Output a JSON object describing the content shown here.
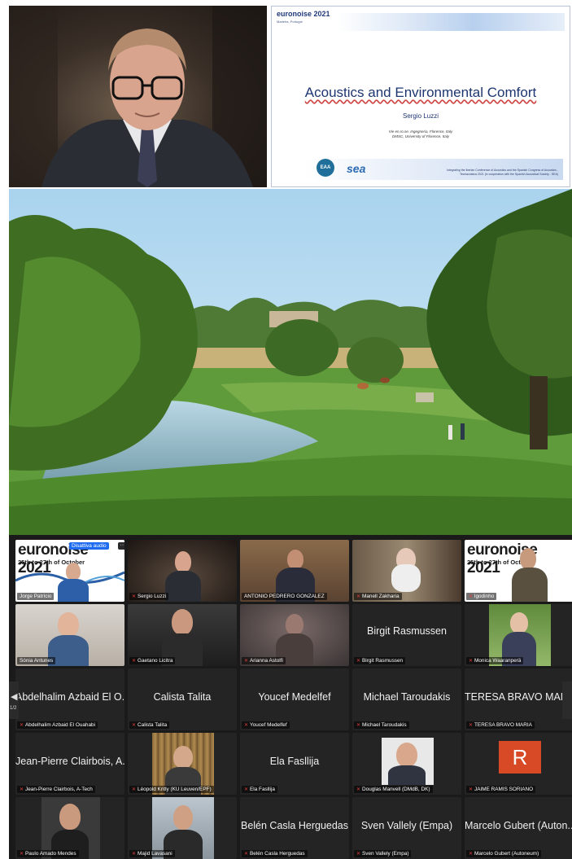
{
  "slide": {
    "logo": "euronoise 2021",
    "logo_sub": "Madeira, Portugal",
    "title": "Acoustics and Environmental Comfort",
    "author": "Sergio Luzzi",
    "affiliation_1": "Vie en.ro.se. Ingegneria, Florence, Italy",
    "affiliation_2": "DMSC, University of Florence, Italy",
    "eaa": "EAA",
    "sea": "sea",
    "footer_text": "Integrating the Iberian Conference of Acoustics and the Spanish Congress of Acoustics - Tecniacústica 2021 (in cooperation with the Spanish Acoustical Society - SEA)"
  },
  "gallery": {
    "euro_bg_text": "euronoise 2021",
    "euro_bg_dates": "25th to 27th of October",
    "active_badge": "Disattiva audio",
    "more_icon": "···",
    "page_indicator": "1/2",
    "avatar_letter": "R",
    "tiles": [
      {
        "label": "Jorge Patrício",
        "center": ""
      },
      {
        "label": "Sergio Luzzi",
        "center": ""
      },
      {
        "label": "ANTONIO PEDRERO GONZALEZ",
        "center": ""
      },
      {
        "label": "Manell Zakharia",
        "center": ""
      },
      {
        "label": "lgodinho",
        "center": ""
      },
      {
        "label": "Sónia Antunes",
        "center": ""
      },
      {
        "label": "Gaetano Licitra",
        "center": ""
      },
      {
        "label": "Arianna Astolfi",
        "center": ""
      },
      {
        "label": "Birgit Rasmussen",
        "center": "Birgit Rasmussen"
      },
      {
        "label": "Monica Waaranperä",
        "center": ""
      },
      {
        "label": "Abdelhalim Azbaid El Ouahabi",
        "center": "Abdelhalim Azbaid El O..."
      },
      {
        "label": "Calista Talita",
        "center": "Calista Talita"
      },
      {
        "label": "Youcef Medelfef",
        "center": "Youcef Medelfef"
      },
      {
        "label": "Michael Taroudakis",
        "center": "Michael Taroudakis"
      },
      {
        "label": "TERESA BRAVO MARIA",
        "center": "TERESA BRAVO MARIA"
      },
      {
        "label": "Jean-Pierre Clairbois, A-Tech",
        "center": "Jean-Pierre Clairbois, A..."
      },
      {
        "label": "Léopold Kritly (KU Leuven/EPF)",
        "center": ""
      },
      {
        "label": "Ela Fasllija",
        "center": "Ela Fasllija"
      },
      {
        "label": "Douglas Manvell (DMdB, DK)",
        "center": ""
      },
      {
        "label": "JAIME RAMIS SORIANO",
        "center": ""
      },
      {
        "label": "Paulo Amado Mendes",
        "center": ""
      },
      {
        "label": "Majid Lavasani",
        "center": ""
      },
      {
        "label": "Belén Casla Herguedas",
        "center": "Belén Casla Herguedas"
      },
      {
        "label": "Sven Vallely (Empa)",
        "center": "Sven Vallely (Empa)"
      },
      {
        "label": "Marcelo Gubert (Autoneum)",
        "center": "Marcelo Gubert (Auton..."
      }
    ]
  }
}
